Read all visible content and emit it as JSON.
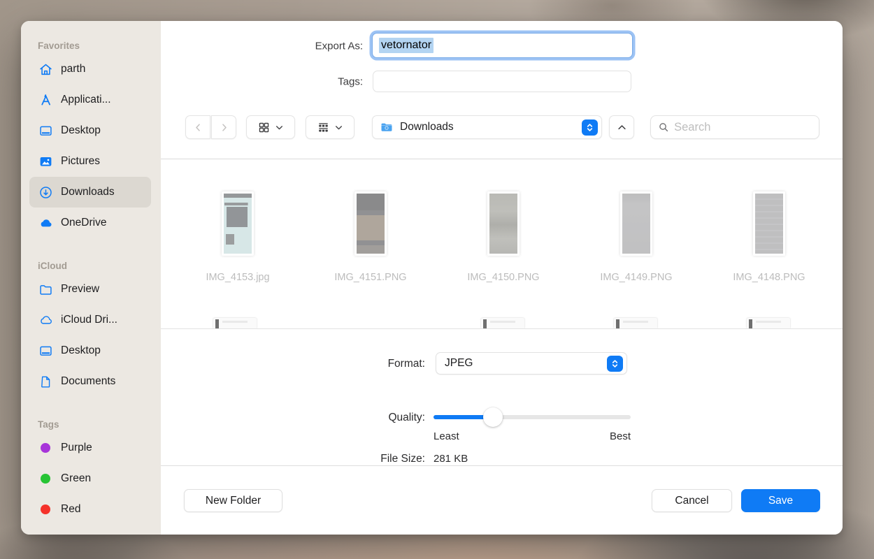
{
  "colors": {
    "accent_blue": "#0f7bf5",
    "selection_blue": "#b3d4f2",
    "sidebar_bg": "#ece8e2",
    "sidebar_selected_bg": "#dcd8d1",
    "folder_blue": "#4aa3f0",
    "tag_purple": "#a735d9",
    "tag_green": "#27c434",
    "tag_red": "#f5322a"
  },
  "dialog": {
    "export_as_label": "Export As:",
    "export_as_value": "vetornator",
    "tags_label": "Tags:",
    "tags_value": ""
  },
  "sidebar": {
    "sections": [
      {
        "title": "Favorites",
        "items": [
          {
            "label": "parth",
            "icon": "home-icon"
          },
          {
            "label": "Applicati...",
            "icon": "applications-icon"
          },
          {
            "label": "Desktop",
            "icon": "desktop-icon"
          },
          {
            "label": "Pictures",
            "icon": "pictures-icon"
          },
          {
            "label": "Downloads",
            "icon": "downloads-icon",
            "selected": true
          },
          {
            "label": "OneDrive",
            "icon": "onedrive-cloud-icon"
          }
        ]
      },
      {
        "title": "iCloud",
        "items": [
          {
            "label": "Preview",
            "icon": "folder-icon"
          },
          {
            "label": "iCloud Dri...",
            "icon": "icloud-cloud-icon"
          },
          {
            "label": "Desktop",
            "icon": "desktop-icon"
          },
          {
            "label": "Documents",
            "icon": "document-icon"
          }
        ]
      },
      {
        "title": "Tags",
        "items": [
          {
            "label": "Purple",
            "color": "#a735d9"
          },
          {
            "label": "Green",
            "color": "#27c434"
          },
          {
            "label": "Red",
            "color": "#f5322a"
          }
        ]
      }
    ]
  },
  "toolbar": {
    "location_value": "Downloads",
    "search_placeholder": "Search",
    "icons": [
      "back-chevron-icon",
      "forward-chevron-icon",
      "grid-view-icon",
      "group-view-icon",
      "folder-icon",
      "stepper-icon",
      "up-chevron-icon",
      "search-icon"
    ]
  },
  "files": [
    {
      "name": "IMG_4153.jpg"
    },
    {
      "name": "IMG_4151.PNG"
    },
    {
      "name": "IMG_4150.PNG"
    },
    {
      "name": "IMG_4149.PNG"
    },
    {
      "name": "IMG_4148.PNG"
    }
  ],
  "format_section": {
    "format_label": "Format:",
    "format_value": "JPEG",
    "quality_label": "Quality:",
    "quality_percent": 30,
    "least_label": "Least",
    "best_label": "Best",
    "file_size_label": "File Size:",
    "file_size_value": "281 KB"
  },
  "footer": {
    "new_folder_label": "New Folder",
    "cancel_label": "Cancel",
    "save_label": "Save"
  }
}
